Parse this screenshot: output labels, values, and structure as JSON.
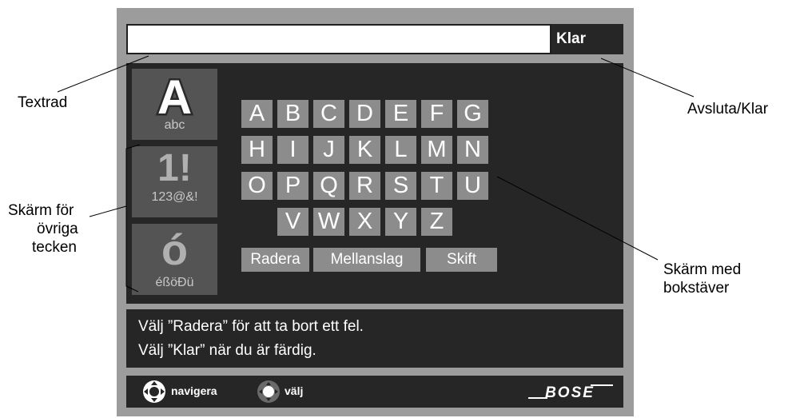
{
  "colors": {
    "frame": "#9c9c9c",
    "panel": "#262626",
    "tile": "#545454",
    "key": "#8c8c8c",
    "text_row": "#ffffff",
    "text_light": "#ffffff"
  },
  "text_row": {
    "value": "",
    "done_label": "Klar"
  },
  "side_tiles": [
    {
      "glyph": "A",
      "caption": "abc",
      "icon": "letters-mode-icon"
    },
    {
      "glyph": "1!",
      "caption": "123@&!",
      "icon": "numbers-symbols-mode-icon"
    },
    {
      "glyph": "ó",
      "caption": "éßöÐü",
      "icon": "special-characters-mode-icon"
    }
  ],
  "keyboard": {
    "rows": [
      [
        "A",
        "B",
        "C",
        "D",
        "E",
        "F",
        "G"
      ],
      [
        "H",
        "I",
        "J",
        "K",
        "L",
        "M",
        "N"
      ],
      [
        "O",
        "P",
        "Q",
        "R",
        "S",
        "T",
        "U"
      ],
      [
        "V",
        "W",
        "X",
        "Y",
        "Z"
      ]
    ],
    "actions": {
      "delete": "Radera",
      "space": "Mellanslag",
      "shift": "Skift"
    }
  },
  "message": {
    "line1": "Välj ”Radera” för att ta bort ett fel.",
    "line2": "Välj ”Klar” när du är färdig."
  },
  "footer": {
    "navigate_label": "navigera",
    "select_label": "välj",
    "navigate_icon": "dpad-navigate-icon",
    "select_icon": "dpad-select-icon",
    "brand": "BOSE"
  },
  "callouts": {
    "text_row": "Textrad",
    "done": "Avsluta/Klar",
    "other_screen_l1": "Skärm för",
    "other_screen_l2": "övriga",
    "other_screen_l3": "tecken",
    "letters_screen_l1": "Skärm med",
    "letters_screen_l2": "bokstäver"
  }
}
